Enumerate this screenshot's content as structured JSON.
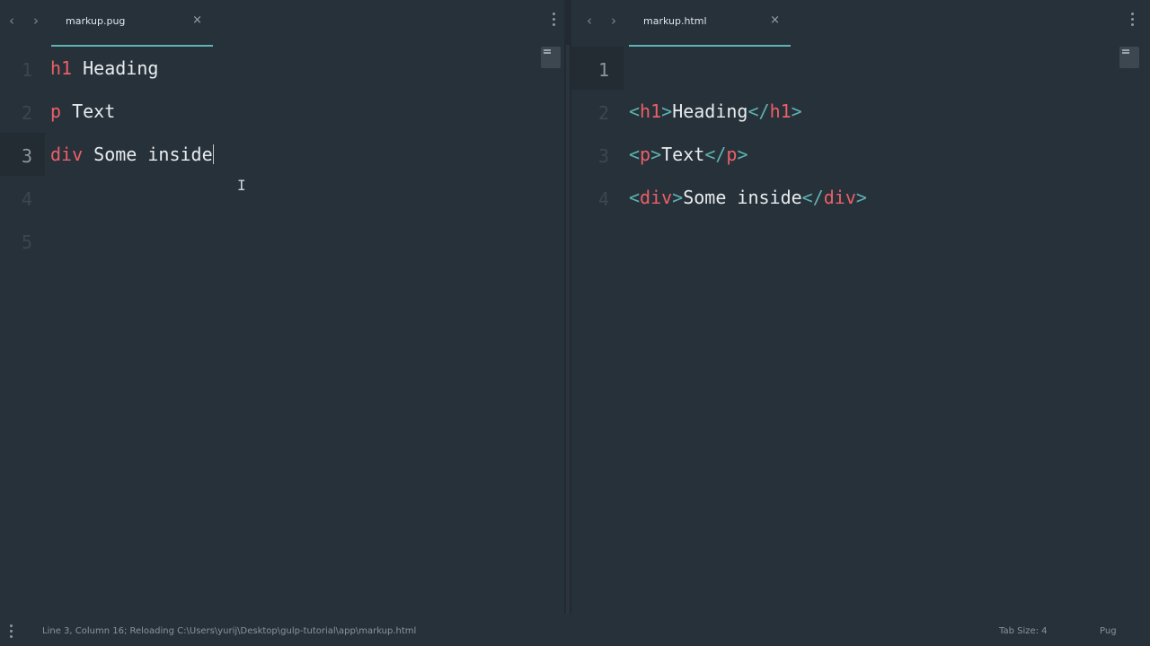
{
  "left_pane": {
    "tab": {
      "label": "markup.pug",
      "close": "×"
    },
    "lines": [
      {
        "num": "1",
        "tag": "h1",
        "text": " Heading"
      },
      {
        "num": "2",
        "tag": "p",
        "text": " Text"
      },
      {
        "num": "3",
        "tag": "div",
        "text": " Some inside"
      },
      {
        "num": "4"
      },
      {
        "num": "5"
      }
    ]
  },
  "right_pane": {
    "tab": {
      "label": "markup.html",
      "close": "×"
    },
    "lines": [
      {
        "num": "1"
      },
      {
        "num": "2",
        "open_tag": "h1",
        "text": "Heading"
      },
      {
        "num": "3",
        "open_tag": "p",
        "text": "Text"
      },
      {
        "num": "4",
        "open_tag": "div",
        "text": "Some inside"
      }
    ]
  },
  "nav": {
    "back": "‹",
    "forward": "›"
  },
  "status": {
    "message": "Line 3, Column 16; Reloading C:\\Users\\yurij\\Desktop\\gulp-tutorial\\app\\markup.html",
    "tab_size": "Tab Size: 4",
    "syntax": "Pug"
  },
  "colors": {
    "tag": "#ec5f67",
    "punctuation": "#5fb3b3",
    "text": "#e8ecee",
    "tab_underline": "#5fb3b3"
  }
}
